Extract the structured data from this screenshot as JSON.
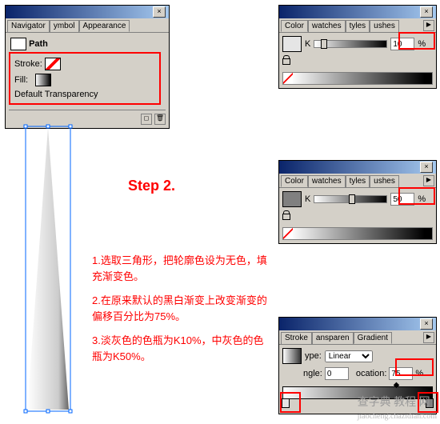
{
  "appearance_panel": {
    "tabs": [
      "Navigator",
      "ymbol",
      "Appearance"
    ],
    "path_label": "Path",
    "stroke_label": "Stroke:",
    "fill_label": "Fill:",
    "transparency_label": "Default Transparency"
  },
  "color_panel_1": {
    "tabs": [
      "Color",
      "watches",
      "tyles",
      "ushes"
    ],
    "channel": "K",
    "value": "10",
    "unit": "%"
  },
  "color_panel_2": {
    "tabs": [
      "Color",
      "watches",
      "tyles",
      "ushes"
    ],
    "channel": "K",
    "value": "50",
    "unit": "%"
  },
  "gradient_panel": {
    "tabs": [
      "Stroke",
      "ansparen",
      "Gradient"
    ],
    "type_label": "ype:",
    "type_value": "Linear",
    "angle_label": "ngle:",
    "angle_value": "0",
    "location_label": "ocation:",
    "location_value": "75",
    "unit": "%"
  },
  "step_title": "Step 2.",
  "instructions": {
    "line1": "1.选取三角形，把轮廓色设为无色，填充渐变色。",
    "line2": "2.在原来默认的黑白渐变上改变渐变的偏移百分比为75%。",
    "line3": "3.淡灰色的色瓶为K10%，中灰色的色瓶为K50%。"
  },
  "watermark": "查字典 教程 网",
  "watermark_url": "jiaocheng.chazidian.com"
}
